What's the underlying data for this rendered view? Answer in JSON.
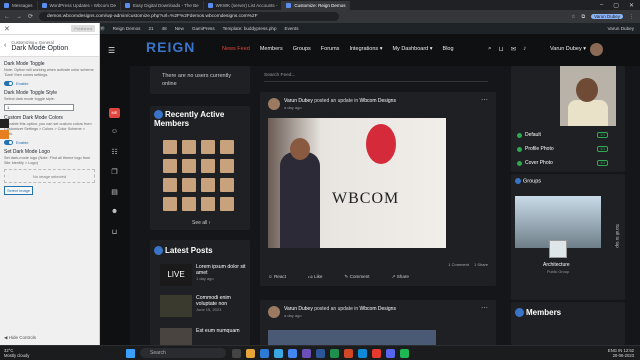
{
  "browser": {
    "tabs": [
      "Messages",
      "WordPress Updates › Wbcom De",
      "Easy Digital Downloads - The Be",
      "WKWK (server) List Accounts -",
      "Customize: Reign Demos"
    ],
    "url": "demos.wbcomdesigns.com/wp-admin/customize.php?url=%2F%2Fdemos.wbcomdesigns.com%2F",
    "profile": "Varun Dubey"
  },
  "wpbar": {
    "site": "Reign Demos",
    "counts": [
      "21",
      "48"
    ],
    "new": "New",
    "items": [
      "GamiPress",
      "Template: buddypress.php",
      "Events"
    ],
    "greet": "Varun Dubey"
  },
  "customizer": {
    "publish": "Published",
    "crumb": "Customizing ▸ General",
    "section": "Dark Mode Option",
    "toggle_title": "Dark Mode Toggle",
    "toggle_desc": "Note: Option will working when activate color scheme 'Dark' then colors settings.",
    "toggle_state": "Enable",
    "style_title": "Dark Mode Toggle Style",
    "style_desc": "Select dark mode toggle style.",
    "style_value": "1",
    "colors_title": "Custom Dark Mode Colors",
    "colors_desc": "If enable this option, you can set custom colors from Customizer Settings > Colors > Color Scheme > Dark.",
    "colors_state": "Enable",
    "logo_title": "Set Dark Mode Logo",
    "logo_desc": "Set dark-mode logo (Note: Find all theme logo from Site Identity > Logo)",
    "no_image": "No image selected",
    "select_image": "Select image",
    "hide": "Hide Controls"
  },
  "site": {
    "logo": "REIGN",
    "nav": [
      "News Feed",
      "Members",
      "Groups",
      "Forums",
      "Integrations ▾",
      "My Dashboard ▾",
      "Blog"
    ],
    "user": "Varun Dubey ▾",
    "online_text": "There are no users currently online",
    "active_title": "Recently Active Members",
    "see_all": "See all",
    "latest_title": "Latest Posts",
    "posts": [
      {
        "title": "Lorem ipsum dolor sit amet",
        "date": "1 day ago"
      },
      {
        "title": "Commodi enim voluptate non",
        "date": "June 15, 2023"
      },
      {
        "title": "Est eum numquam",
        "date": ""
      }
    ],
    "search_placeholder": "Search Feed...",
    "activity": [
      {
        "author": "Varun Dubey",
        "action": "posted an update in",
        "group": "Wbcom Designs",
        "date": "a day ago",
        "brand": "WBCOM"
      },
      {
        "author": "Varun Dubey",
        "action": "posted an update in",
        "group": "Wbcom Designs",
        "date": "a day ago"
      }
    ],
    "stats": [
      "1 Comment",
      "1 Share"
    ],
    "actions": [
      "React",
      "Like",
      "Comment",
      "Share"
    ],
    "right_items": [
      {
        "label": "Default",
        "badge": "1/1"
      },
      {
        "label": "Profile Photo",
        "badge": "1/1"
      },
      {
        "label": "Cover Photo",
        "badge": "1/1"
      }
    ],
    "groups_title": "Groups",
    "group_name": "Architecture",
    "group_type": "Public Group",
    "members_title": "Members",
    "scroll_top": "Scroll to top"
  },
  "taskbar": {
    "temp": "32°C",
    "weather": "Mostly cloudy",
    "search": "Search",
    "lang": "ENG IN",
    "time": "12:52",
    "date": "20-06-2023"
  }
}
